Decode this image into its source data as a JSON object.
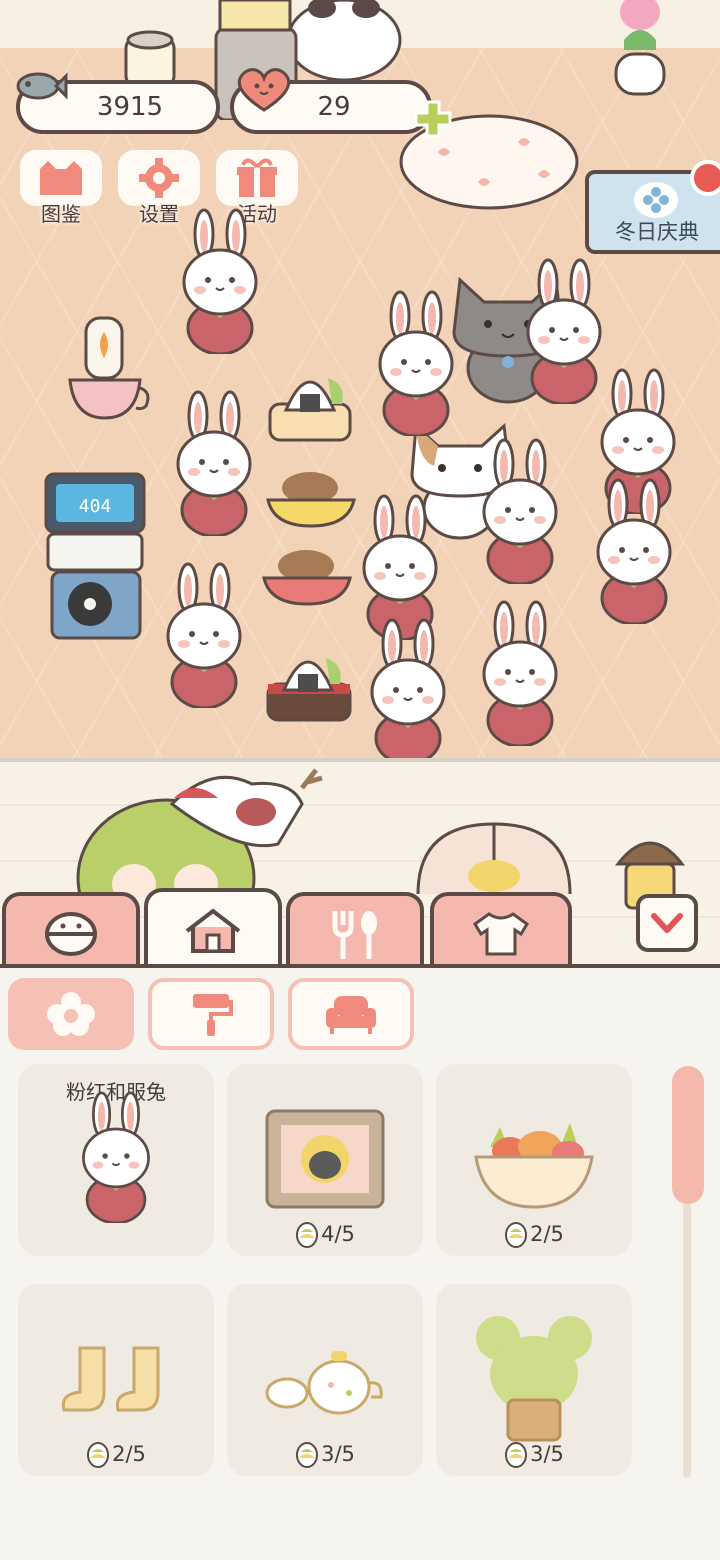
{
  "hud": {
    "fish_count": "3915",
    "heart_count": "29"
  },
  "menu": [
    {
      "label": "图鉴",
      "icon": "cat-face-icon"
    },
    {
      "label": "设置",
      "icon": "gear-icon"
    },
    {
      "label": "活动",
      "icon": "gift-icon"
    }
  ],
  "event": {
    "label": "冬日庆典"
  },
  "tabs": [
    {
      "icon": "food-bowl-icon",
      "active": false
    },
    {
      "icon": "house-icon",
      "active": true
    },
    {
      "icon": "fork-spoon-icon",
      "active": false
    },
    {
      "icon": "shirt-icon",
      "active": false
    }
  ],
  "subtabs": [
    {
      "icon": "flower-icon",
      "active": true
    },
    {
      "icon": "paint-roller-icon",
      "active": false
    },
    {
      "icon": "sofa-icon",
      "active": false
    }
  ],
  "items": [
    {
      "name": "粉红和服兔",
      "count": "",
      "art": "rabbit-kimono"
    },
    {
      "name": "",
      "count": "4/5",
      "art": "framed-picture"
    },
    {
      "name": "",
      "count": "2/5",
      "art": "vegetable-basket"
    },
    {
      "name": "",
      "count": "2/5",
      "art": "boots"
    },
    {
      "name": "",
      "count": "3/5",
      "art": "tea-set"
    },
    {
      "name": "",
      "count": "3/5",
      "art": "potted-plant"
    }
  ],
  "colors": {
    "floor": "#f2d3b7",
    "accent_pink": "#f4b8ae",
    "outline": "#5b4a45",
    "panel": "#f6f4ef"
  }
}
